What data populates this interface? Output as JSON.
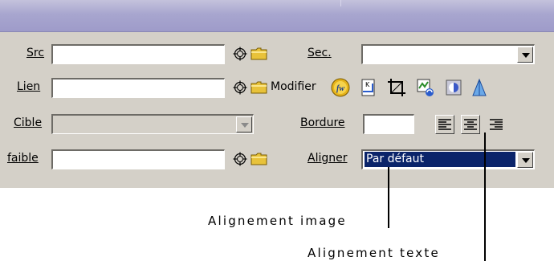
{
  "inspector": {
    "src_label": "Src",
    "sec_label": "Sec.",
    "lien_label": "Lien",
    "modifier_label": "Modifier",
    "cible_label": "Cible",
    "bordure_label": "Bordure",
    "faible_label": "faible",
    "aligner_label": "Aligner",
    "align_select_value": "Par défaut"
  },
  "callouts": {
    "image_alignment": "Alignement image",
    "text_alignment": "Alignement texte"
  },
  "colors": {
    "panel": "#d4d0c8",
    "titlebar": "#a8a6cf",
    "selection": "#0a246a"
  },
  "icons": [
    "point-to-file-icon",
    "browse-folder-icon",
    "edit-fireworks-icon",
    "crop-icon",
    "resample-icon",
    "brightness-icon",
    "sharpen-icon",
    "align-left-icon",
    "align-center-icon",
    "align-right-icon"
  ]
}
